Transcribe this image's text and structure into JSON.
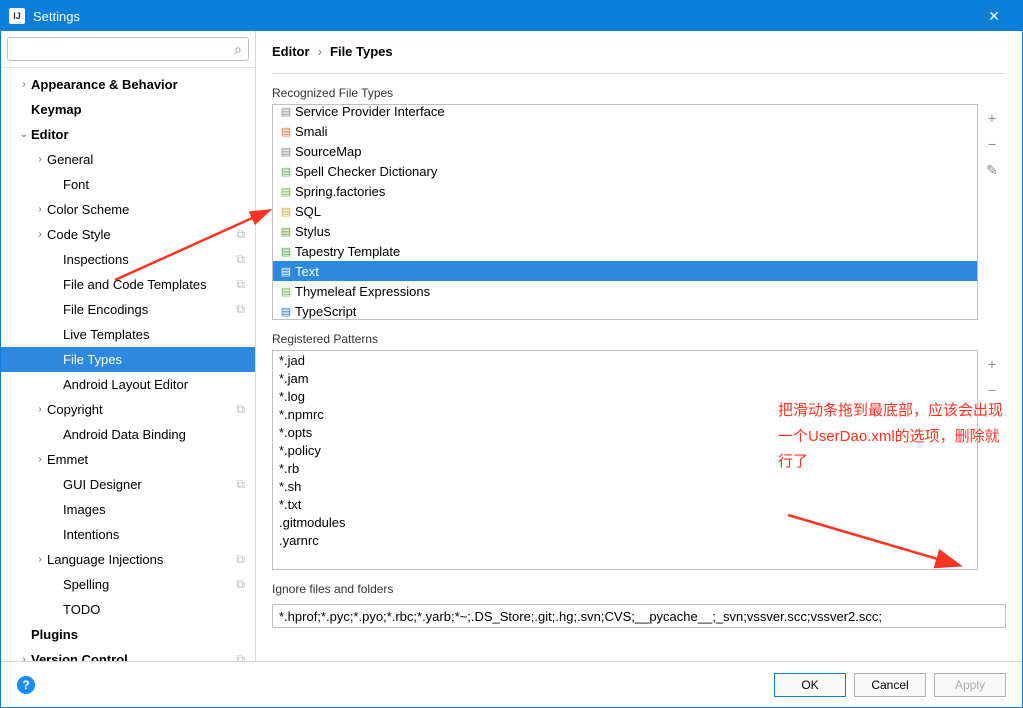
{
  "window": {
    "title": "Settings"
  },
  "search": {
    "placeholder": ""
  },
  "tree": [
    {
      "label": "Appearance & Behavior",
      "level": 0,
      "chev": "›",
      "bold": true
    },
    {
      "label": "Keymap",
      "level": 0,
      "chev": "",
      "bold": true
    },
    {
      "label": "Editor",
      "level": 0,
      "chev": "⌄",
      "bold": true
    },
    {
      "label": "General",
      "level": 1,
      "chev": "›"
    },
    {
      "label": "Font",
      "level": 2,
      "chev": ""
    },
    {
      "label": "Color Scheme",
      "level": 1,
      "chev": "›"
    },
    {
      "label": "Code Style",
      "level": 1,
      "chev": "›",
      "copy": true
    },
    {
      "label": "Inspections",
      "level": 2,
      "chev": "",
      "copy": true
    },
    {
      "label": "File and Code Templates",
      "level": 2,
      "chev": "",
      "copy": true
    },
    {
      "label": "File Encodings",
      "level": 2,
      "chev": "",
      "copy": true
    },
    {
      "label": "Live Templates",
      "level": 2,
      "chev": ""
    },
    {
      "label": "File Types",
      "level": 2,
      "chev": "",
      "selected": true
    },
    {
      "label": "Android Layout Editor",
      "level": 2,
      "chev": ""
    },
    {
      "label": "Copyright",
      "level": 1,
      "chev": "›",
      "copy": true
    },
    {
      "label": "Android Data Binding",
      "level": 2,
      "chev": ""
    },
    {
      "label": "Emmet",
      "level": 1,
      "chev": "›"
    },
    {
      "label": "GUI Designer",
      "level": 2,
      "chev": "",
      "copy": true
    },
    {
      "label": "Images",
      "level": 2,
      "chev": ""
    },
    {
      "label": "Intentions",
      "level": 2,
      "chev": ""
    },
    {
      "label": "Language Injections",
      "level": 1,
      "chev": "›",
      "copy": true
    },
    {
      "label": "Spelling",
      "level": 2,
      "chev": "",
      "copy": true
    },
    {
      "label": "TODO",
      "level": 2,
      "chev": ""
    },
    {
      "label": "Plugins",
      "level": 0,
      "chev": "",
      "bold": true
    },
    {
      "label": "Version Control",
      "level": 0,
      "chev": "›",
      "bold": true,
      "copy": true
    }
  ],
  "breadcrumb": {
    "a": "Editor",
    "sep": "›",
    "b": "File Types"
  },
  "recognized": {
    "label": "Recognized File Types",
    "items": [
      {
        "name": "Service Provider Interface",
        "iconColor": "#888"
      },
      {
        "name": "Smali",
        "iconColor": "#e07030"
      },
      {
        "name": "SourceMap",
        "iconColor": "#888"
      },
      {
        "name": "Spell Checker Dictionary",
        "iconColor": "#55aa55"
      },
      {
        "name": "Spring.factories",
        "iconColor": "#6db33f"
      },
      {
        "name": "SQL",
        "iconColor": "#d9a840"
      },
      {
        "name": "Stylus",
        "iconColor": "#6b9b3b"
      },
      {
        "name": "Tapestry Template",
        "iconColor": "#46a546"
      },
      {
        "name": "Text",
        "iconColor": "#fff",
        "selected": true
      },
      {
        "name": "Thymeleaf Expressions",
        "iconColor": "#6db33f"
      },
      {
        "name": "TypeScript",
        "iconColor": "#3178c6"
      }
    ]
  },
  "patterns": {
    "label": "Registered Patterns",
    "items": [
      "*.jad",
      "*.jam",
      "*.log",
      "*.npmrc",
      "*.opts",
      "*.policy",
      "*.rb",
      "*.sh",
      "*.txt",
      ".gitmodules",
      ".yarnrc"
    ]
  },
  "ignore": {
    "label": "Ignore files and folders",
    "value": "*.hprof;*.pyc;*.pyo;*.rbc;*.yarb;*~;.DS_Store;.git;.hg;.svn;CVS;__pycache__;_svn;vssver.scc;vssver2.scc;"
  },
  "buttons": {
    "ok": "OK",
    "cancel": "Cancel",
    "apply": "Apply"
  },
  "annotation": "把滑动条拖到最底部，应该会出现一个UserDao.xml的选项，删除就行了"
}
